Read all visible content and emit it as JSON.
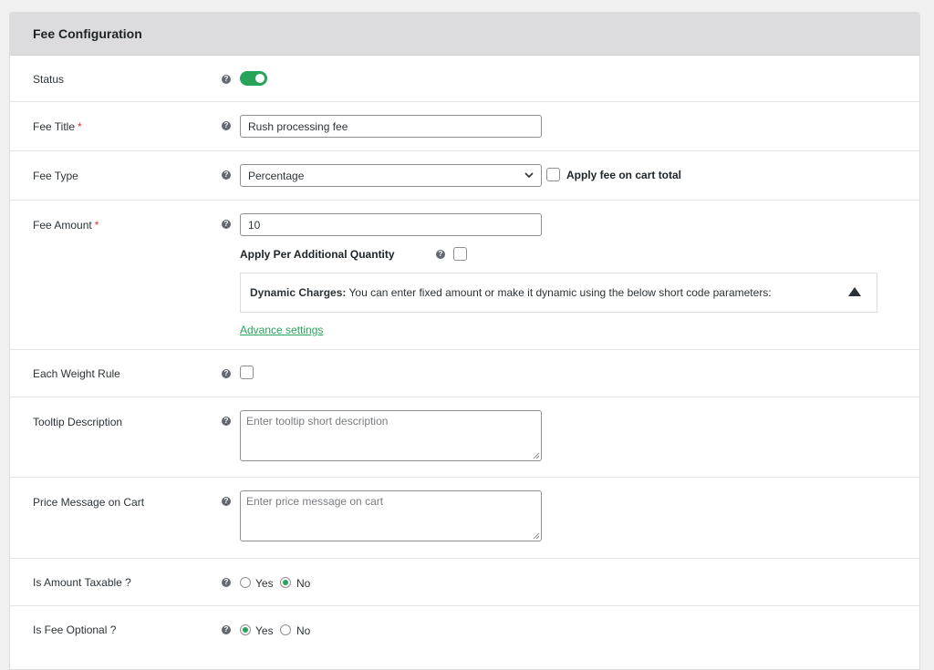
{
  "panel": {
    "title": "Fee Configuration"
  },
  "status": {
    "label": "Status",
    "enabled": true
  },
  "fee_title": {
    "label": "Fee Title",
    "required_mark": "*",
    "value": "Rush processing fee"
  },
  "fee_type": {
    "label": "Fee Type",
    "selected": "Percentage",
    "checkbox_label": "Apply fee on cart total"
  },
  "fee_amount": {
    "label": "Fee Amount",
    "required_mark": "*",
    "value": "10",
    "per_qty_label": "Apply Per Additional Quantity",
    "dynamic_title": "Dynamic Charges:",
    "dynamic_text": "You can enter fixed amount or make it dynamic using the below short code parameters:",
    "advance_link": "Advance settings"
  },
  "weight_rule": {
    "label": "Each Weight Rule"
  },
  "tooltip": {
    "label": "Tooltip Description",
    "placeholder": "Enter tooltip short description"
  },
  "price_message": {
    "label": "Price Message on Cart",
    "placeholder": "Enter price message on cart"
  },
  "taxable": {
    "label": "Is Amount Taxable ?",
    "yes": "Yes",
    "no": "No",
    "selected": "No"
  },
  "optional": {
    "label": "Is Fee Optional ?",
    "yes": "Yes",
    "no": "No",
    "selected": "Yes"
  },
  "icons": {
    "help": "?",
    "help_icon": "question-circle-icon",
    "toggle_color": "#27a35a"
  }
}
